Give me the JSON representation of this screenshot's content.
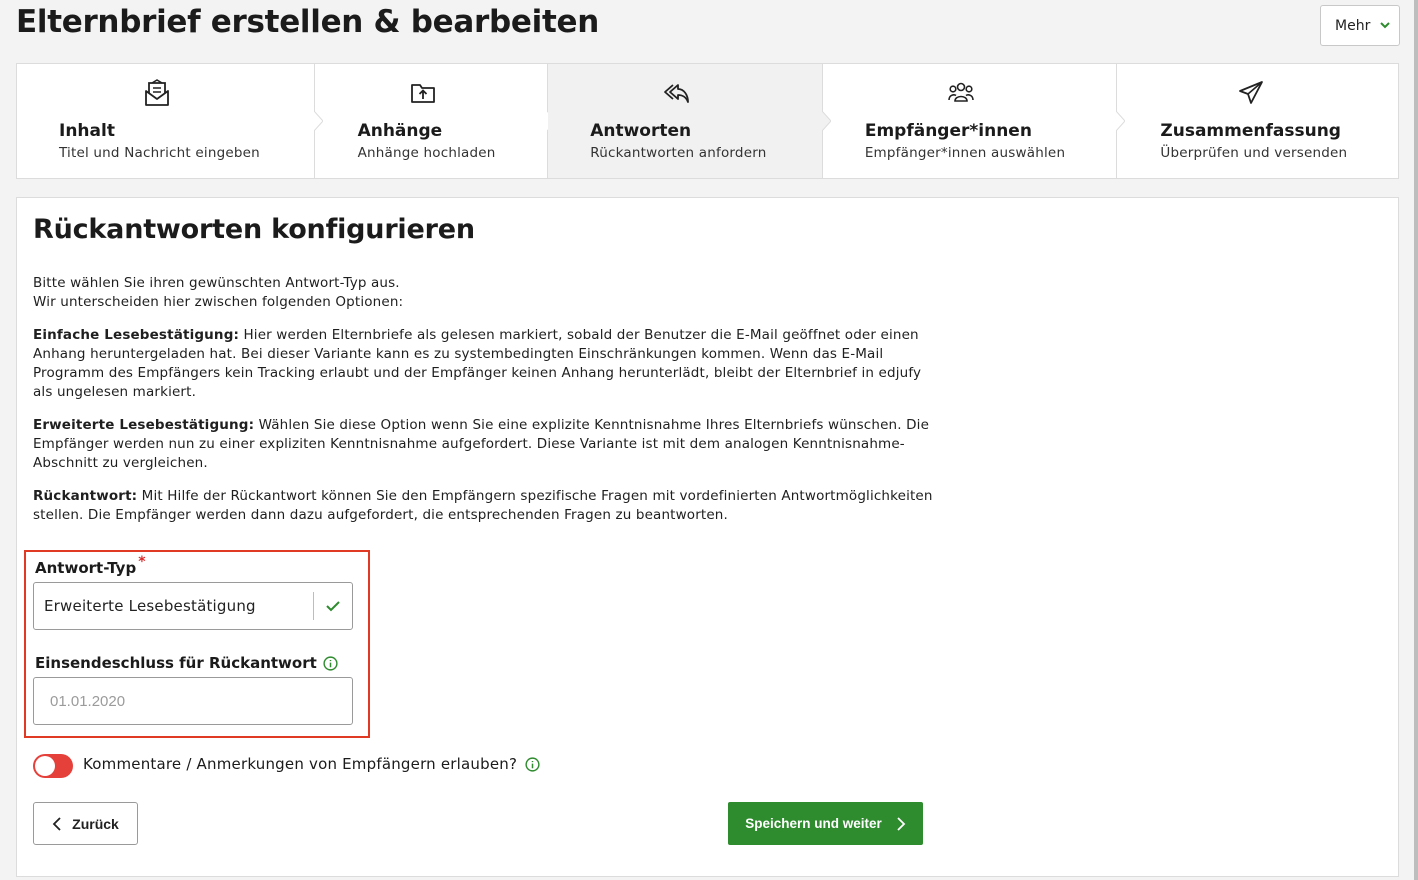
{
  "header": {
    "title": "Elternbrief erstellen & bearbeiten",
    "more_label": "Mehr"
  },
  "steps": [
    {
      "title": "Inhalt",
      "subtitle": "Titel und Nachricht eingeben",
      "icon": "envelope-letter-icon",
      "active": false
    },
    {
      "title": "Anhänge",
      "subtitle": "Anhänge hochladen",
      "icon": "folder-upload-icon",
      "active": false
    },
    {
      "title": "Antworten",
      "subtitle": "Rückantworten anfordern",
      "icon": "reply-all-icon",
      "active": true
    },
    {
      "title": "Empfänger*innen",
      "subtitle": "Empfänger*innen auswählen",
      "icon": "users-icon",
      "active": false
    },
    {
      "title": "Zusammenfassung",
      "subtitle": "Überprüfen und versenden",
      "icon": "paper-plane-icon",
      "active": false
    }
  ],
  "panel": {
    "title": "Rückantworten konfigurieren",
    "intro_line1": "Bitte wählen Sie ihren gewünschten Antwort-Typ aus.",
    "intro_line2": "Wir unterscheiden hier zwischen folgenden Optionen:",
    "opt1_label": "Einfache Lesebestätigung:",
    "opt1_text": " Hier werden Elternbriefe als gelesen markiert, sobald der Benutzer die E-Mail geöffnet oder einen Anhang heruntergeladen hat. Bei dieser Variante kann es zu systembedingten Einschränkungen kommen. Wenn das E-Mail Programm des Empfängers kein Tracking erlaubt und der Empfänger keinen Anhang herunterlädt, bleibt der Elternbrief in edjufy als ungelesen markiert.",
    "opt2_label": "Erweiterte Lesebestätigung:",
    "opt2_text": " Wählen Sie diese Option wenn Sie eine explizite Kenntnisnahme Ihres Elternbriefs wünschen. Die Empfänger werden nun zu einer expliziten Kenntnisnahme aufgefordert. Diese Variante ist mit dem analogen Kenntnisnahme-Abschnitt zu vergleichen.",
    "opt3_label": "Rückantwort:",
    "opt3_text": " Mit Hilfe der Rückantwort können Sie den Empfängern spezifische Fragen mit vordefinierten Antwortmöglichkeiten stellen. Die Empfänger werden dann dazu aufgefordert, die entsprechenden Fragen zu beantworten.",
    "answer_type_label": "Antwort-Typ",
    "required_mark": "*",
    "answer_type_value": "Erweiterte Lesebestätigung",
    "deadline_label": "Einsendeschluss für Rückantwort",
    "deadline_placeholder": "01.01.2020",
    "comments_label": "Kommentare / Anmerkungen von Empfängern erlauben?",
    "comments_enabled": false,
    "back_label": "Zurück",
    "next_label": "Speichern und weiter"
  },
  "colors": {
    "accent_green": "#2e8b2e",
    "toggle_red": "#e5403a",
    "highlight_red": "#e03a24"
  }
}
